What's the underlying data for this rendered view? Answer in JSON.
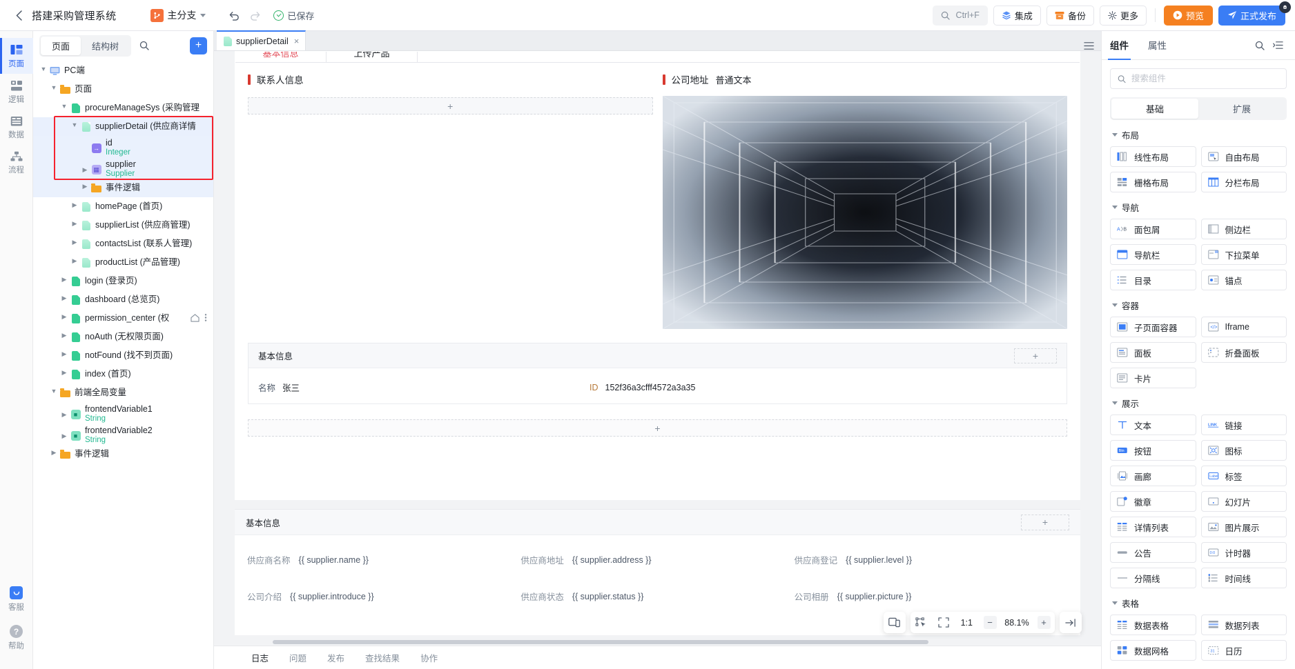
{
  "topbar": {
    "back_icon": "chevron-left-icon",
    "title": "搭建采购管理系统",
    "branch_label": "主分支",
    "branch_icon": "branch-icon",
    "undo_icon": "undo-icon",
    "redo_icon": "redo-icon",
    "saved_label": "已保存",
    "search_label": "Ctrl+F",
    "search_icon": "search-icon",
    "integrate_label": "集成",
    "integrate_icon": "layers-icon",
    "backup_label": "备份",
    "backup_icon": "archive-icon",
    "more_label": "更多",
    "more_icon": "gear-icon",
    "preview_label": "预览",
    "preview_icon": "play-icon",
    "publish_label": "正式发布",
    "publish_icon": "send-icon",
    "accent_orange": "#f58020",
    "accent_blue": "#3a7df5"
  },
  "rail": {
    "items": [
      {
        "label": "页面",
        "icon": "pages-icon",
        "active": true
      },
      {
        "label": "逻辑",
        "icon": "logic-icon",
        "active": false
      },
      {
        "label": "数据",
        "icon": "data-icon",
        "active": false
      },
      {
        "label": "流程",
        "icon": "flow-icon",
        "active": false
      }
    ],
    "bottom": [
      {
        "label": "客服",
        "icon": "support-icon"
      },
      {
        "label": "帮助",
        "icon": "help-icon"
      }
    ]
  },
  "left_panel": {
    "tabs": [
      {
        "label": "页面",
        "active": true
      },
      {
        "label": "结构树",
        "active": false
      }
    ],
    "search_icon": "search-icon",
    "add_label": "+",
    "tree": [
      {
        "indent": 0,
        "arrow": "down",
        "icon": "monitor-icon",
        "label": "PC端"
      },
      {
        "indent": 1,
        "arrow": "down",
        "icon": "folder-icon",
        "label": "页面"
      },
      {
        "indent": 2,
        "arrow": "down",
        "icon": "page-solid-icon",
        "label": "procureManageSys (采购管理"
      },
      {
        "indent": 3,
        "arrow": "down",
        "icon": "page-icon",
        "label": "supplierDetail (供应商详情",
        "selected": true,
        "boxed": true
      },
      {
        "indent": 4,
        "arrow": "none",
        "icon": "var-in-icon",
        "label": "id",
        "type": "Integer",
        "boxed": true
      },
      {
        "indent": 4,
        "arrow": "right",
        "icon": "var-obj-icon",
        "label": "supplier",
        "type": "Supplier",
        "boxed": true
      },
      {
        "indent": 4,
        "arrow": "right",
        "icon": "folder-icon",
        "label": "事件逻辑"
      },
      {
        "indent": 3,
        "arrow": "right",
        "icon": "page-icon",
        "label": "homePage (首页)"
      },
      {
        "indent": 3,
        "arrow": "right",
        "icon": "page-icon",
        "label": "supplierList (供应商管理)"
      },
      {
        "indent": 3,
        "arrow": "right",
        "icon": "page-icon",
        "label": "contactsList (联系人管理)"
      },
      {
        "indent": 3,
        "arrow": "right",
        "icon": "page-icon",
        "label": "productList (产品管理)"
      },
      {
        "indent": 2,
        "arrow": "right",
        "icon": "page-solid-icon",
        "label": "login (登录页)"
      },
      {
        "indent": 2,
        "arrow": "right",
        "icon": "page-solid-icon",
        "label": "dashboard (总览页)"
      },
      {
        "indent": 2,
        "arrow": "right",
        "icon": "page-solid-icon",
        "label": "permission_center (权",
        "hover_icons": [
          "home-icon",
          "more-icon"
        ]
      },
      {
        "indent": 2,
        "arrow": "right",
        "icon": "page-solid-icon",
        "label": "noAuth (无权限页面)"
      },
      {
        "indent": 2,
        "arrow": "right",
        "icon": "page-solid-icon",
        "label": "notFound (找不到页面)"
      },
      {
        "indent": 2,
        "arrow": "right",
        "icon": "page-solid-icon",
        "label": "index (首页)"
      },
      {
        "indent": 1,
        "arrow": "down",
        "icon": "folder-icon",
        "label": "前端全局变量"
      },
      {
        "indent": 2,
        "arrow": "right",
        "icon": "var-str-icon",
        "label": "frontendVariable1",
        "type": "String"
      },
      {
        "indent": 2,
        "arrow": "right",
        "icon": "var-str-icon",
        "label": "frontendVariable2",
        "type": "String"
      },
      {
        "indent": 1,
        "arrow": "right",
        "icon": "folder-icon",
        "label": "事件逻辑"
      }
    ]
  },
  "center": {
    "tab": {
      "label": "supplierDetail",
      "close": "×",
      "icon": "page-icon"
    },
    "list_icon": "list-icon",
    "page_tabs": [
      {
        "label": "基本信息",
        "active": true
      },
      {
        "label": "上传产品",
        "active": false
      }
    ],
    "contact_section": {
      "title": "联系人信息",
      "slot_plus": "+"
    },
    "address_section": {
      "title": "公司地址",
      "subtitle": "普通文本"
    },
    "basic_panel": {
      "title": "基本信息",
      "plus": "+",
      "fields": [
        {
          "label": "名称",
          "value": "张三",
          "label_color": "#4e5969"
        },
        {
          "label": "ID",
          "value": "152f36a3cfff4572a3a35",
          "label_color": "#b77a3a"
        }
      ]
    },
    "bottom_slot_plus": "+",
    "form_panel": {
      "title": "基本信息",
      "plus": "+",
      "fields": [
        {
          "label": "供应商名称",
          "value": "{{ supplier.name }}"
        },
        {
          "label": "供应商地址",
          "value": "{{ supplier.address }}"
        },
        {
          "label": "供应商登记",
          "value": "{{ supplier.level }}"
        },
        {
          "label": "公司介绍",
          "value": "{{ supplier.introduce }}"
        },
        {
          "label": "供应商状态",
          "value": "{{ supplier.status }}"
        },
        {
          "label": "公司相册",
          "value": "{{ supplier.picture }}"
        }
      ]
    },
    "zoombar": {
      "device_icon": "device-icon",
      "select_icon": "select-pointer-icon",
      "fit_icon": "fit-screen-icon",
      "one_to_one": "1:1",
      "minus": "−",
      "zoom_value": "88.1%",
      "plus": "+",
      "collapse_icon": "collapse-right-icon"
    }
  },
  "statusbar": {
    "items": [
      {
        "label": "日志",
        "active": true
      },
      {
        "label": "问题",
        "active": false
      },
      {
        "label": "发布",
        "active": false
      },
      {
        "label": "查找结果",
        "active": false
      },
      {
        "label": "协作",
        "active": false
      }
    ]
  },
  "right_panel": {
    "tabs": [
      {
        "label": "组件",
        "active": true
      },
      {
        "label": "属性",
        "active": false
      }
    ],
    "search_icon": "search-icon",
    "expand_icon": "expand-list-icon",
    "search_placeholder": "搜索组件",
    "search_value": "",
    "seg": [
      {
        "label": "基础",
        "active": true
      },
      {
        "label": "扩展",
        "active": false
      }
    ],
    "groups": [
      {
        "title": "布局",
        "items": [
          {
            "label": "线性布局",
            "icon": "linear-layout-icon"
          },
          {
            "label": "自由布局",
            "icon": "free-layout-icon"
          },
          {
            "label": "栅格布局",
            "icon": "grid-layout-icon"
          },
          {
            "label": "分栏布局",
            "icon": "column-layout-icon"
          }
        ]
      },
      {
        "title": "导航",
        "items": [
          {
            "label": "面包屑",
            "icon": "breadcrumb-icon"
          },
          {
            "label": "侧边栏",
            "icon": "sidebar-icon"
          },
          {
            "label": "导航栏",
            "icon": "navbar-icon"
          },
          {
            "label": "下拉菜单",
            "icon": "dropdown-icon"
          },
          {
            "label": "目录",
            "icon": "toc-icon"
          },
          {
            "label": "锚点",
            "icon": "anchor-icon"
          }
        ]
      },
      {
        "title": "容器",
        "items": [
          {
            "label": "子页面容器",
            "icon": "subpage-container-icon"
          },
          {
            "label": "Iframe",
            "icon": "iframe-icon"
          },
          {
            "label": "面板",
            "icon": "panel-icon"
          },
          {
            "label": "折叠面板",
            "icon": "collapse-panel-icon"
          },
          {
            "label": "卡片",
            "icon": "card-icon"
          }
        ]
      },
      {
        "title": "展示",
        "items": [
          {
            "label": "文本",
            "icon": "text-icon"
          },
          {
            "label": "链接",
            "icon": "link-icon"
          },
          {
            "label": "按钮",
            "icon": "button-icon"
          },
          {
            "label": "图标",
            "icon": "icon-icon"
          },
          {
            "label": "画廊",
            "icon": "gallery-icon"
          },
          {
            "label": "标签",
            "icon": "label-icon"
          },
          {
            "label": "徽章",
            "icon": "badge-icon"
          },
          {
            "label": "幻灯片",
            "icon": "carousel-icon"
          },
          {
            "label": "详情列表",
            "icon": "detail-list-icon"
          },
          {
            "label": "图片展示",
            "icon": "image-icon"
          },
          {
            "label": "公告",
            "icon": "notice-icon"
          },
          {
            "label": "计时器",
            "icon": "timer-icon"
          },
          {
            "label": "分隔线",
            "icon": "divider-icon"
          },
          {
            "label": "时间线",
            "icon": "timeline-icon"
          }
        ]
      },
      {
        "title": "表格",
        "items": [
          {
            "label": "数据表格",
            "icon": "data-table-icon"
          },
          {
            "label": "数据列表",
            "icon": "data-list-icon"
          },
          {
            "label": "数据网格",
            "icon": "data-grid-icon"
          },
          {
            "label": "日历",
            "icon": "calendar-icon"
          }
        ]
      }
    ]
  }
}
